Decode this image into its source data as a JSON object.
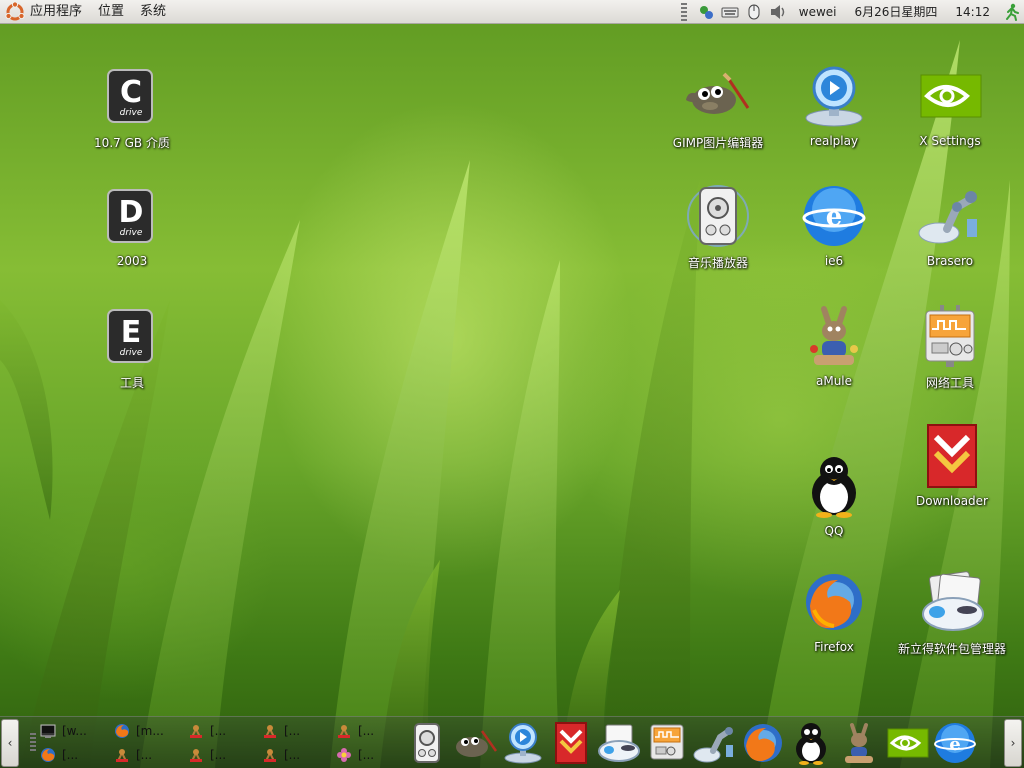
{
  "top_panel": {
    "menus": [
      "应用程序",
      "位置",
      "系统"
    ],
    "username": "wewei",
    "date": "6月26日星期四",
    "time": "14:12"
  },
  "desktop": {
    "left_icons": [
      {
        "label": "10.7 GB 介质",
        "icon": "c-drive-icon",
        "letter": "C"
      },
      {
        "label": "2003",
        "icon": "d-drive-icon",
        "letter": "D"
      },
      {
        "label": "工具",
        "icon": "e-drive-icon",
        "letter": "E"
      }
    ],
    "right_icons": [
      {
        "label": "GIMP图片编辑器",
        "icon": "gimp-icon"
      },
      {
        "label": "realplay",
        "icon": "realplay-icon"
      },
      {
        "label": "X Settings",
        "icon": "nvidia-icon"
      },
      {
        "label": "音乐播放器",
        "icon": "music-player-icon"
      },
      {
        "label": "ie6",
        "icon": "ie-icon"
      },
      {
        "label": "Brasero",
        "icon": "brasero-icon"
      },
      {
        "label": "aMule",
        "icon": "amule-icon"
      },
      {
        "label": "网络工具",
        "icon": "network-tools-icon"
      },
      {
        "label": "Downloader",
        "icon": "downloader-icon"
      },
      {
        "label": "QQ",
        "icon": "qq-penguin-icon"
      },
      {
        "label": "Firefox",
        "icon": "firefox-icon"
      },
      {
        "label": "新立得软件包管理器",
        "icon": "synaptic-icon"
      }
    ],
    "drive_caption": "drive"
  },
  "bottom_panel": {
    "left_arrow": "‹",
    "right_arrow": "›",
    "tasks": [
      {
        "label": "[w...",
        "icon": "terminal-icon"
      },
      {
        "label": "[m...",
        "icon": "firefox-icon"
      },
      {
        "label": "[...",
        "icon": "amule-small-icon"
      },
      {
        "label": "[...",
        "icon": "amule-small-icon"
      },
      {
        "label": "[...",
        "icon": "amule-small-icon"
      },
      {
        "label": "[...",
        "icon": "firefox-icon"
      },
      {
        "label": "[...",
        "icon": "amule-small-icon"
      },
      {
        "label": "[...",
        "icon": "amule-small-icon"
      },
      {
        "label": "[...",
        "icon": "amule-small-icon"
      },
      {
        "label": "[...",
        "icon": "flower-icon"
      }
    ],
    "dock": [
      "music-player-icon",
      "gimp-icon",
      "realplay-icon",
      "downloader-icon",
      "synaptic-icon",
      "network-tools-icon",
      "brasero-icon",
      "firefox-icon",
      "qq-penguin-icon",
      "amule-icon",
      "nvidia-icon",
      "ie-icon"
    ]
  }
}
